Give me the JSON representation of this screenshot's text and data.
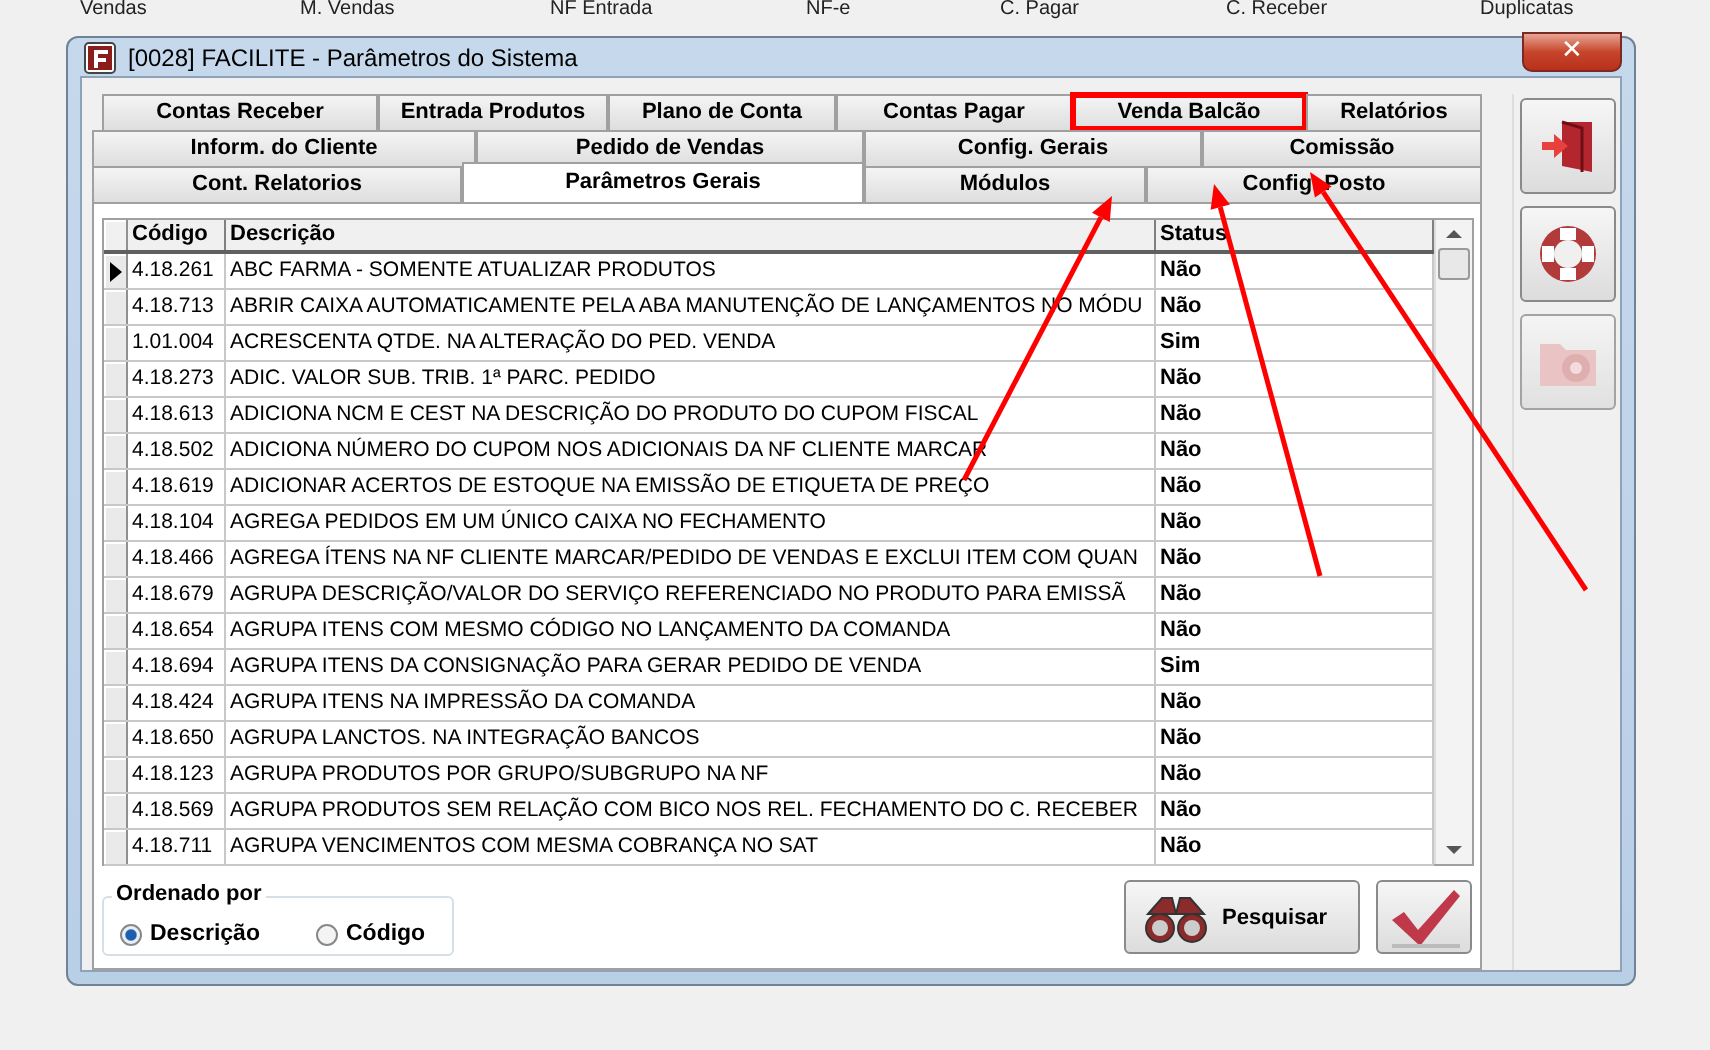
{
  "menu_bar": [
    "Vendas",
    "M. Vendas",
    "NF Entrada",
    "NF-e",
    "C. Pagar",
    "C. Receber",
    "Duplicatas"
  ],
  "window": {
    "title": "[0028] FACILITE - Parâmetros do Sistema",
    "close_label": "✕"
  },
  "tab_rows": [
    [
      {
        "label": "Contas Receber",
        "selected": false,
        "highlighted": false
      },
      {
        "label": "Entrada Produtos",
        "selected": false,
        "highlighted": false
      },
      {
        "label": "Plano de Conta",
        "selected": false,
        "highlighted": false
      },
      {
        "label": "Contas Pagar",
        "selected": false,
        "highlighted": false
      },
      {
        "label": "Venda Balcão",
        "selected": false,
        "highlighted": true
      },
      {
        "label": "Relatórios",
        "selected": false,
        "highlighted": false
      }
    ],
    [
      {
        "label": "Inform. do Cliente",
        "selected": false,
        "highlighted": false
      },
      {
        "label": "Pedido de Vendas",
        "selected": false,
        "highlighted": false
      },
      {
        "label": "Config. Gerais",
        "selected": false,
        "highlighted": false
      },
      {
        "label": "Comissão",
        "selected": false,
        "highlighted": false
      }
    ],
    [
      {
        "label": "Cont. Relatorios",
        "selected": false,
        "highlighted": false
      },
      {
        "label": "Parâmetros Gerais",
        "selected": true,
        "highlighted": false
      },
      {
        "label": "Módulos",
        "selected": false,
        "highlighted": false
      },
      {
        "label": "Config. Posto",
        "selected": false,
        "highlighted": false
      }
    ]
  ],
  "table": {
    "columns": [
      "Código",
      "Descrição",
      "Status"
    ],
    "rows": [
      {
        "code": "4.18.261",
        "description": "ABC FARMA - SOMENTE ATUALIZAR PRODUTOS",
        "status": "Não",
        "current": true
      },
      {
        "code": "4.18.713",
        "description": "ABRIR CAIXA AUTOMATICAMENTE PELA ABA MANUTENÇÃO DE LANÇAMENTOS NO MÓDU",
        "status": "Não",
        "current": false
      },
      {
        "code": "1.01.004",
        "description": "ACRESCENTA QTDE. NA ALTERAÇÃO DO PED. VENDA",
        "status": "Sim",
        "current": false
      },
      {
        "code": "4.18.273",
        "description": "ADIC. VALOR SUB. TRIB. 1ª PARC. PEDIDO",
        "status": "Não",
        "current": false
      },
      {
        "code": "4.18.613",
        "description": "ADICIONA NCM E CEST NA DESCRIÇÃO DO PRODUTO DO CUPOM FISCAL",
        "status": "Não",
        "current": false
      },
      {
        "code": "4.18.502",
        "description": "ADICIONA NÚMERO DO CUPOM NOS ADICIONAIS DA NF CLIENTE MARCAR",
        "status": "Não",
        "current": false
      },
      {
        "code": "4.18.619",
        "description": "ADICIONAR ACERTOS DE ESTOQUE NA EMISSÃO DE ETIQUETA DE PREÇO",
        "status": "Não",
        "current": false
      },
      {
        "code": "4.18.104",
        "description": "AGREGA PEDIDOS EM UM ÚNICO CAIXA NO FECHAMENTO",
        "status": "Não",
        "current": false
      },
      {
        "code": "4.18.466",
        "description": "AGREGA ÍTENS NA NF CLIENTE MARCAR/PEDIDO DE VENDAS E EXCLUI ITEM COM QUAN",
        "status": "Não",
        "current": false
      },
      {
        "code": "4.18.679",
        "description": "AGRUPA DESCRIÇÃO/VALOR DO SERVIÇO REFERENCIADO NO PRODUTO PARA EMISSÃ",
        "status": "Não",
        "current": false
      },
      {
        "code": "4.18.654",
        "description": "AGRUPA ITENS COM MESMO CÓDIGO NO LANÇAMENTO DA COMANDA",
        "status": "Não",
        "current": false
      },
      {
        "code": "4.18.694",
        "description": "AGRUPA ITENS DA CONSIGNAÇÃO PARA GERAR PEDIDO DE VENDA",
        "status": "Sim",
        "current": false
      },
      {
        "code": "4.18.424",
        "description": "AGRUPA ITENS NA IMPRESSÃO DA COMANDA",
        "status": "Não",
        "current": false
      },
      {
        "code": "4.18.650",
        "description": "AGRUPA LANCTOS. NA INTEGRAÇÃO BANCOS",
        "status": "Não",
        "current": false
      },
      {
        "code": "4.18.123",
        "description": "AGRUPA PRODUTOS POR GRUPO/SUBGRUPO NA NF",
        "status": "Não",
        "current": false
      },
      {
        "code": "4.18.569",
        "description": "AGRUPA PRODUTOS SEM RELAÇÃO COM BICO NOS REL. FECHAMENTO DO C. RECEBER",
        "status": "Não",
        "current": false
      },
      {
        "code": "4.18.711",
        "description": "AGRUPA VENCIMENTOS COM MESMA COBRANÇA NO SAT",
        "status": "Não",
        "current": false
      }
    ]
  },
  "sort_group": {
    "title": "Ordenado por",
    "options": [
      {
        "label": "Descrição",
        "selected": true
      },
      {
        "label": "Código",
        "selected": false
      }
    ]
  },
  "search_button": "Pesquisar",
  "side_buttons": [
    {
      "kind": "exit",
      "disabled": false
    },
    {
      "kind": "help",
      "disabled": false
    },
    {
      "kind": "settings",
      "disabled": true
    }
  ]
}
